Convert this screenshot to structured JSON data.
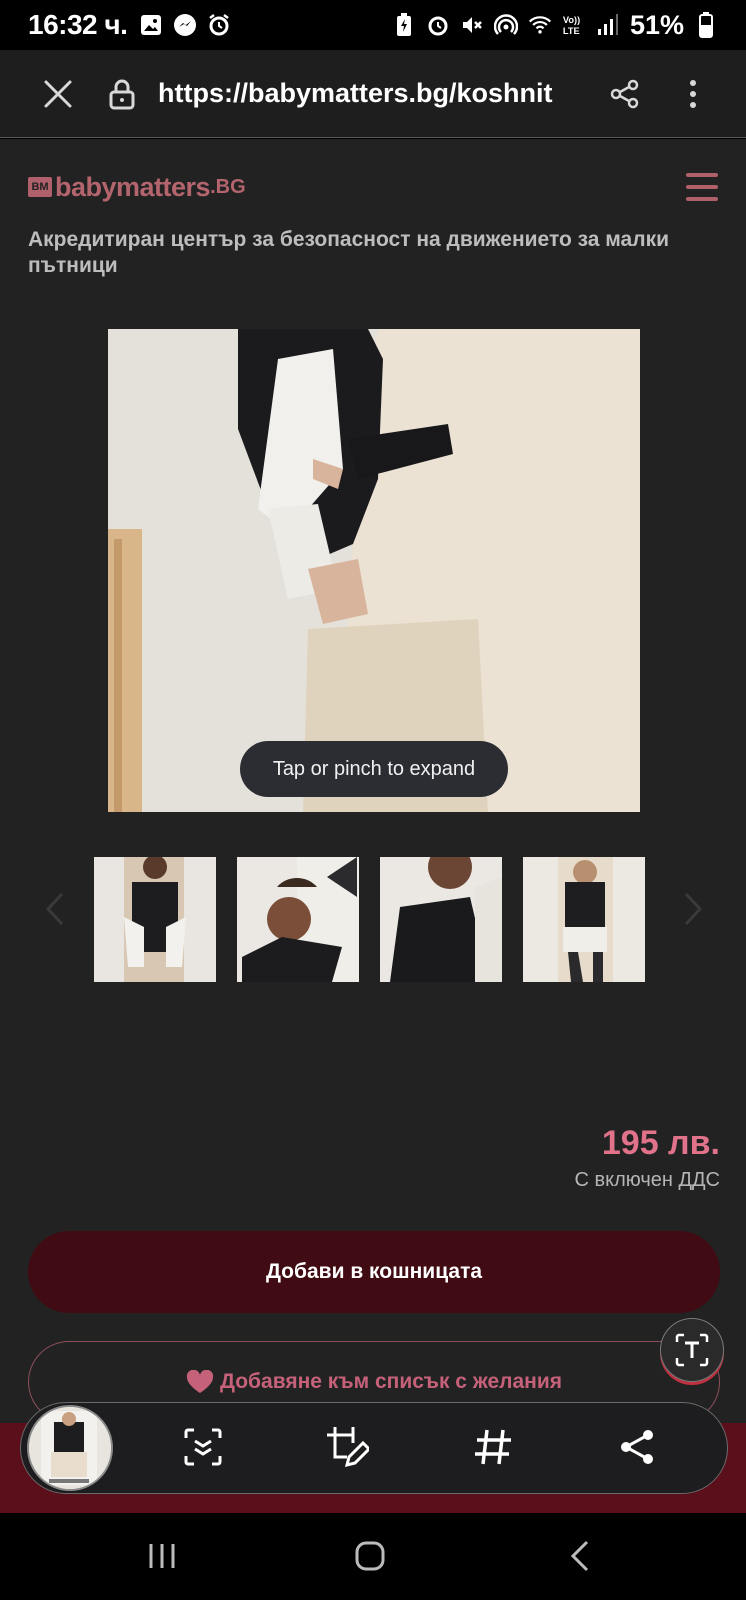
{
  "status_bar": {
    "time": "16:32 ч.",
    "battery": "51%"
  },
  "browser": {
    "url": "https://babymatters.bg/koshnit"
  },
  "site": {
    "logo_mark": "BM",
    "logo_text": "babymatters",
    "logo_suffix": ".BG",
    "tagline": "Акредитиран център за безопасност на движението за малки пътници",
    "accent_color": "#b3646d"
  },
  "product": {
    "expand_hint": "Tap or pinch to expand",
    "price": "195 лв.",
    "vat_note": "С включен ДДС",
    "add_to_cart": "Добави в кошницата",
    "wishlist": "Добавяне към списък с желания",
    "thumbnails": [
      "thumbnail-1",
      "thumbnail-2",
      "thumbnail-3",
      "thumbnail-4"
    ]
  },
  "toolbar": {
    "icons": [
      "scan-icon",
      "edit-crop-icon",
      "hashtag-icon",
      "share-icon"
    ]
  },
  "icons": {
    "status_left": [
      "gallery-icon",
      "messenger-icon",
      "alarm-icon"
    ],
    "status_right": [
      "battery-saver-icon",
      "alarm-icon",
      "mute-icon",
      "hotspot-icon",
      "wifi-icon",
      "volte-icon",
      "signal-icon",
      "battery-icon"
    ],
    "nav": [
      "recents-icon",
      "home-icon",
      "back-icon"
    ]
  }
}
